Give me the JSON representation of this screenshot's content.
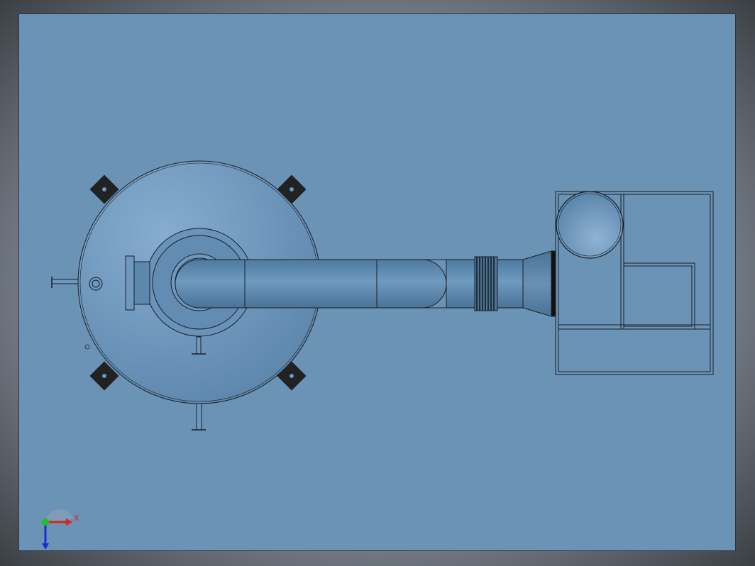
{
  "viewport": {
    "background": "#6b93b5",
    "frame": "#2b3440"
  },
  "model": {
    "body_color": "#6f98bf",
    "pipe_color": "#5d88ae",
    "outline_color": "#1a1f26",
    "bracket_color": "#222222"
  },
  "triad": {
    "x_label": "X",
    "y_label": "",
    "z_label": "",
    "x_color": "#e0201a",
    "y_color": "#1fbf2a",
    "z_color": "#1f2bd6"
  }
}
